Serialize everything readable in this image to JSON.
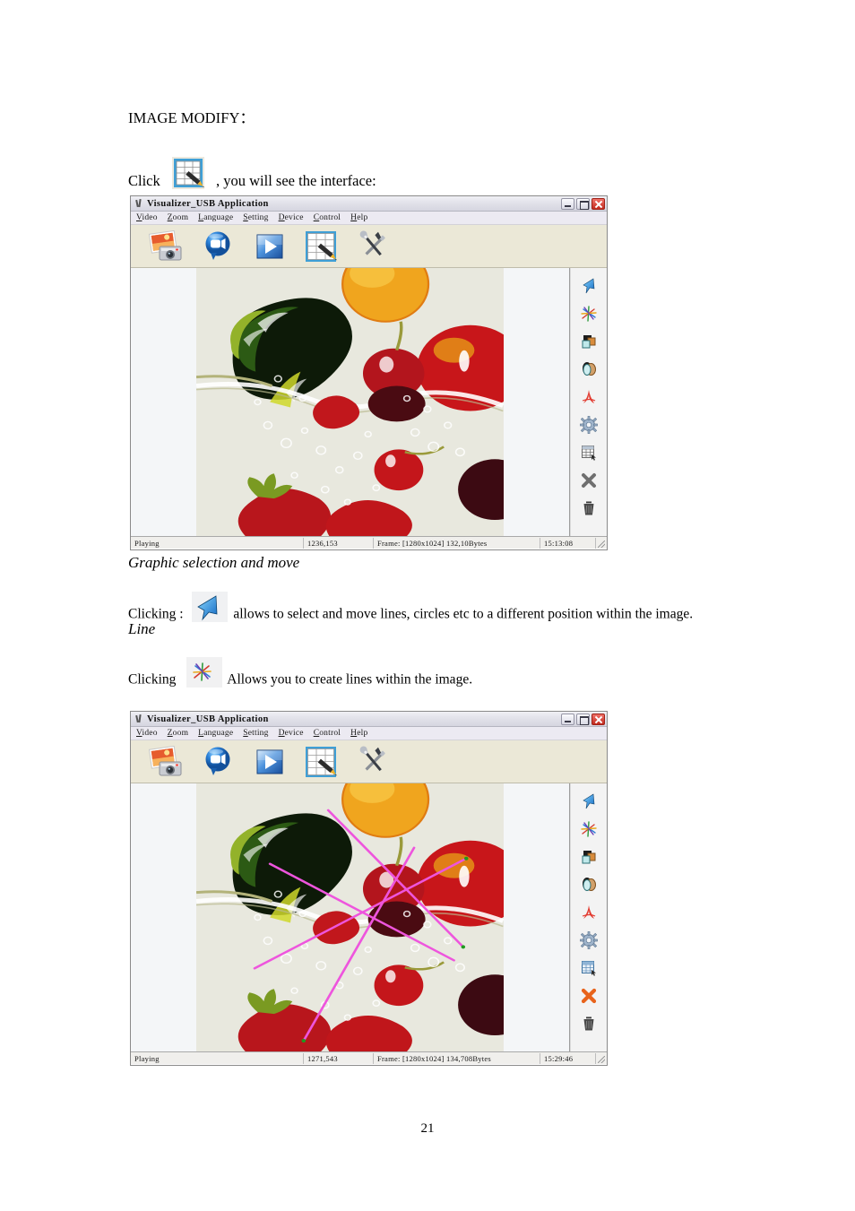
{
  "document": {
    "section_title": "IMAGE MODIFY：",
    "click_prefix": "Click",
    "click_suffix": ", you will see the interface:",
    "subheading_1": "Graphic selection and move",
    "clicking_1_prefix": "Clicking :",
    "clicking_1_suffix": "allows to select and move lines, circles etc to a different position within the image.",
    "subheading_2": "Line",
    "clicking_2_prefix": "Clicking",
    "clicking_2_suffix": "Allows you to create lines within the image.",
    "page_number": "21"
  },
  "window": {
    "title": "Visualizer_USB Application",
    "title_icon": "scissors-icon",
    "buttons": {
      "minimize": "minimize-button",
      "maximize": "maximize-button",
      "close": "close-button"
    },
    "menu": [
      {
        "label": "Video",
        "mnemonic": "V",
        "rest": "ideo"
      },
      {
        "label": "Zoom",
        "mnemonic": "Z",
        "rest": "oom"
      },
      {
        "label": "Language",
        "mnemonic": "L",
        "rest": "anguage"
      },
      {
        "label": "Setting",
        "mnemonic": "S",
        "rest": "etting"
      },
      {
        "label": "Device",
        "mnemonic": "D",
        "rest": "evice"
      },
      {
        "label": "Control",
        "mnemonic": "C",
        "rest": "ontrol"
      },
      {
        "label": "Help",
        "mnemonic": "H",
        "rest": "elp"
      }
    ],
    "toolbar": [
      {
        "icon": "photo-capture-icon",
        "label": "Capture Photo"
      },
      {
        "icon": "video-record-icon",
        "label": "Record Video"
      },
      {
        "icon": "play-icon",
        "label": "Play"
      },
      {
        "icon": "image-modify-icon",
        "label": "Image Modify",
        "selected": true
      },
      {
        "icon": "tools-icon",
        "label": "Tools"
      }
    ],
    "tool_palette": [
      {
        "icon": "arrow-select-icon",
        "label": "Graphic selection and move"
      },
      {
        "icon": "line-draw-icon",
        "label": "Line"
      },
      {
        "icon": "rectangle-icon",
        "label": "Rectangle"
      },
      {
        "icon": "ellipse-icon",
        "label": "Ellipse"
      },
      {
        "icon": "curve-icon",
        "label": "Curve"
      },
      {
        "icon": "gear-icon",
        "label": "Settings"
      },
      {
        "icon": "table-grid-icon",
        "label": "Table"
      },
      {
        "icon": "delete-x-icon",
        "label": "Delete"
      },
      {
        "icon": "trash-icon",
        "label": "Trash"
      }
    ]
  },
  "screenshot_1": {
    "status": {
      "state": "Playing",
      "coords": "1236,153",
      "frame": "Frame: [1280x1024] 132,10Bytes",
      "time": "15:13:08"
    },
    "active_tool": "arrow-select-icon"
  },
  "screenshot_2": {
    "status": {
      "state": "Playing",
      "coords": "1271,543",
      "frame": "Frame: [1280x1024] 134,708Bytes",
      "time": "15:29:46"
    },
    "active_tool": "delete-x-icon",
    "annotation_color": "#ee55dd",
    "annotation_lines": [
      {
        "x1": 0.43,
        "y1": 0.1,
        "x2": 0.87,
        "y2": 0.61
      },
      {
        "x1": 0.19,
        "y1": 0.69,
        "x2": 0.88,
        "y2": 0.28
      },
      {
        "x1": 0.24,
        "y1": 0.3,
        "x2": 0.84,
        "y2": 0.66
      },
      {
        "x1": 0.71,
        "y1": 0.24,
        "x2": 0.35,
        "y2": 0.96
      }
    ]
  },
  "colors": {
    "toolbar_bg": "#ebe8d7",
    "menubar_bg": "#eceaf2",
    "titlebar_bg": "#e4e4ec",
    "palette_bg": "#f3f3f3",
    "close_red": "#c32a1d",
    "accent_blue": "#2f86d8"
  }
}
